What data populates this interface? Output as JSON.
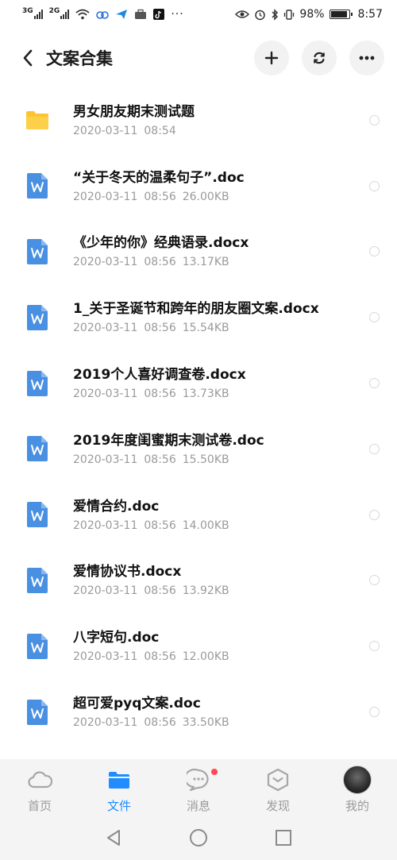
{
  "status_bar": {
    "sig1": "3G",
    "sig2": "2G",
    "battery_pct": "98%",
    "time": "8:57"
  },
  "header": {
    "title": "文案合集"
  },
  "files": [
    {
      "type": "folder",
      "name": "男女朋友期末测试题",
      "date": "2020-03-11",
      "time": "08:54",
      "size": ""
    },
    {
      "type": "doc",
      "name": "“关于冬天的温柔句子”.doc",
      "date": "2020-03-11",
      "time": "08:56",
      "size": "26.00KB"
    },
    {
      "type": "doc",
      "name": "《少年的你》经典语录.docx",
      "date": "2020-03-11",
      "time": "08:56",
      "size": "13.17KB"
    },
    {
      "type": "doc",
      "name": "1_关于圣诞节和跨年的朋友圈文案.docx",
      "date": "2020-03-11",
      "time": "08:56",
      "size": "15.54KB"
    },
    {
      "type": "doc",
      "name": "2019个人喜好调查卷.docx",
      "date": "2020-03-11",
      "time": "08:56",
      "size": "13.73KB"
    },
    {
      "type": "doc",
      "name": "2019年度闺蜜期末测试卷.doc",
      "date": "2020-03-11",
      "time": "08:56",
      "size": "15.50KB"
    },
    {
      "type": "doc",
      "name": "爱情合约.doc",
      "date": "2020-03-11",
      "time": "08:56",
      "size": "14.00KB"
    },
    {
      "type": "doc",
      "name": "爱情协议书.docx",
      "date": "2020-03-11",
      "time": "08:56",
      "size": "13.92KB"
    },
    {
      "type": "doc",
      "name": "八字短句.doc",
      "date": "2020-03-11",
      "time": "08:56",
      "size": "12.00KB"
    },
    {
      "type": "doc",
      "name": "超可爱pyq文案.doc",
      "date": "2020-03-11",
      "time": "08:56",
      "size": "33.50KB"
    }
  ],
  "tabs": [
    {
      "label": "首页",
      "icon": "cloud-icon",
      "active": false
    },
    {
      "label": "文件",
      "icon": "folder-icon",
      "active": true
    },
    {
      "label": "消息",
      "icon": "message-icon",
      "active": false,
      "badge": true
    },
    {
      "label": "发现",
      "icon": "discover-icon",
      "active": false
    },
    {
      "label": "我的",
      "icon": "avatar",
      "active": false
    }
  ],
  "colors": {
    "accent": "#1f8cff",
    "doc_icon": "#4a90e2",
    "folder": "#fbc531",
    "badge": "#ff4757"
  }
}
